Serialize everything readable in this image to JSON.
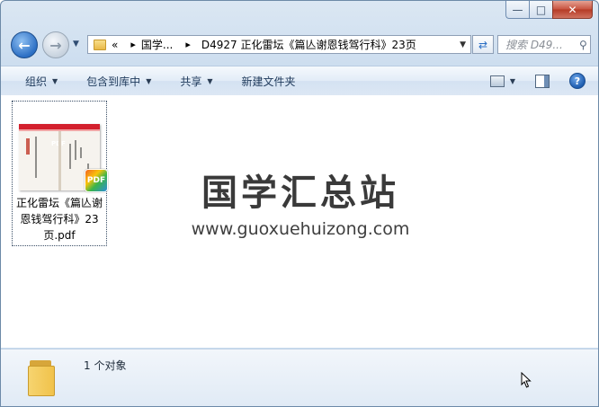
{
  "window": {
    "caption_buttons": {
      "minimize": "—",
      "maximize": "□",
      "close": "✕"
    }
  },
  "nav": {
    "back_icon": "arrow-left-icon",
    "forward_icon": "arrow-right-icon",
    "breadcrumb": {
      "overflow": "«",
      "items": [
        "国学...",
        "D4927 正化雷坛《篇亾谢恩钱驾行科》23页"
      ],
      "separator": "▸"
    },
    "search_placeholder": "搜索 D49..."
  },
  "toolbar": {
    "organize": "组织",
    "include_in_library": "包含到库中",
    "share": "共享",
    "new_folder": "新建文件夹"
  },
  "content": {
    "file": {
      "name": "正化雷坛《篇亾谢恩钱驾行科》23页.pdf",
      "badge": "PDF",
      "thumb_tag": "PDF"
    },
    "watermark": {
      "title": "国学汇总站",
      "url": "www.guoxuehuizong.com"
    }
  },
  "details": {
    "count_text": "1 个对象"
  },
  "colors": {
    "accent_blue": "#2c6fc4",
    "close_red": "#c8523e",
    "pdf_red": "#d3202d"
  }
}
